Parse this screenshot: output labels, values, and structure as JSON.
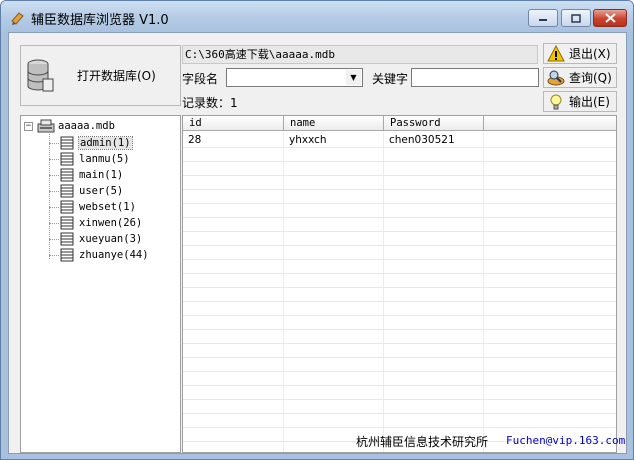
{
  "window": {
    "title": "辅臣数据库浏览器 V1.0"
  },
  "toolbar": {
    "open_label": "打开数据库(O)",
    "path": "C:\\360高速下载\\aaaaa.mdb",
    "field_label": "字段名",
    "field_value": "",
    "keyword_label": "关键字",
    "keyword_value": "",
    "record_count_label": "记录数：1"
  },
  "side_buttons": {
    "exit": "退出(X)",
    "query": "查询(Q)",
    "export": "输出(E)"
  },
  "tree": {
    "root": "aaaaa.mdb",
    "items": [
      "admin(1)",
      "lanmu(5)",
      "main(1)",
      "user(5)",
      "webset(1)",
      "xinwen(26)",
      "xueyuan(3)",
      "zhuanye(44)"
    ]
  },
  "grid": {
    "columns": [
      "id",
      "name",
      "Password"
    ],
    "rows": [
      [
        "28",
        "yhxxch",
        "chen030521"
      ]
    ]
  },
  "footer": {
    "org": "杭州辅臣信息技术研究所",
    "email": "Fuchen@vip.163.com"
  },
  "colors": {
    "titlebar": "#b5cce6",
    "close_button": "#c8442e",
    "link": "#0000d0"
  },
  "icons": {
    "title": "database-browser-icon",
    "open": "database-icon",
    "exit": "warning-icon",
    "query": "search-icon",
    "export": "lightbulb-icon"
  }
}
